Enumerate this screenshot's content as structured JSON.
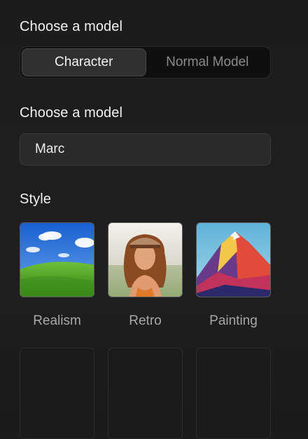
{
  "sections": {
    "model_type_title": "Choose a model",
    "model_title": "Choose a model",
    "style_title": "Style"
  },
  "model_type": {
    "options": [
      "Character",
      "Normal Model"
    ],
    "selected": "Character"
  },
  "model_select": {
    "value": "Marc"
  },
  "styles": [
    {
      "label": "Realism",
      "image": "green-hill-landscape"
    },
    {
      "label": "Retro",
      "image": "retro-portrait"
    },
    {
      "label": "Painting",
      "image": "colorful-mountain-painting"
    }
  ],
  "colors": {
    "background": "#1e1e1e",
    "active_segment": "#303030",
    "input_bg": "#2a2a2a",
    "muted_text": "#8a8a8a"
  }
}
